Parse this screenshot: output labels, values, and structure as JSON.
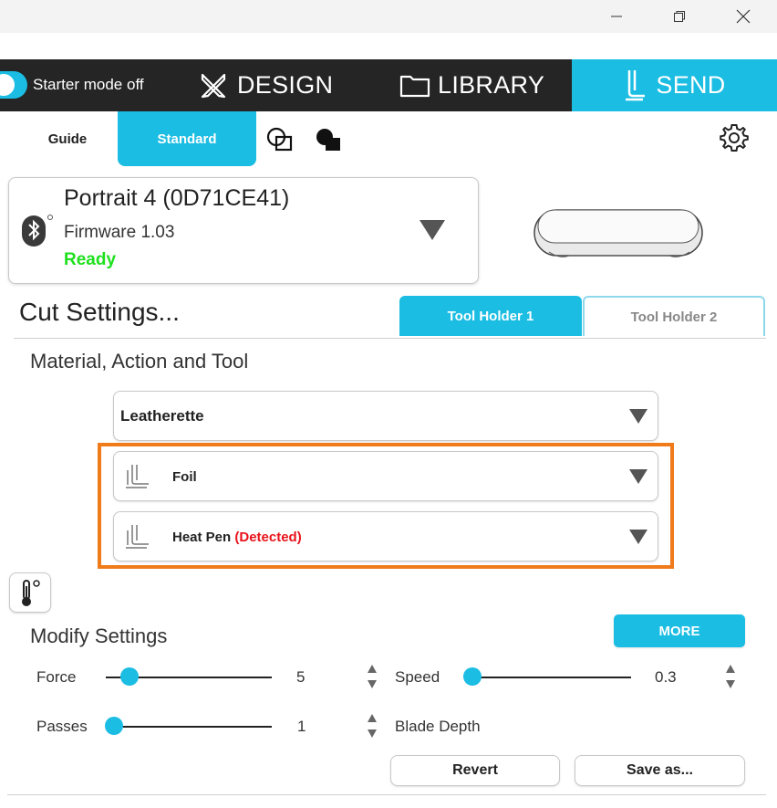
{
  "window": {
    "controls": [
      "minimize",
      "maximize",
      "close"
    ]
  },
  "nav": {
    "starter_mode_label": "Starter mode off",
    "design_label": "DESIGN",
    "library_label": "LIBRARY",
    "send_label": "SEND"
  },
  "subtabs": {
    "guide_label": "Guide",
    "standard_label": "Standard"
  },
  "device": {
    "name": "Portrait 4 (0D71CE41)",
    "firmware": "Firmware 1.03",
    "status": "Ready"
  },
  "cut_settings": {
    "title": "Cut Settings...",
    "tool_holder_1": "Tool Holder 1",
    "tool_holder_2": "Tool Holder 2",
    "section_label": "Material, Action and Tool",
    "material": "Leatherette",
    "action": "Foil",
    "tool": "Heat Pen",
    "tool_status": "(Detected)"
  },
  "modify": {
    "title": "Modify Settings",
    "more_label": "MORE",
    "force_label": "Force",
    "force_value": "5",
    "speed_label": "Speed",
    "speed_value": "0.3",
    "passes_label": "Passes",
    "passes_value": "1",
    "blade_depth_label": "Blade Depth",
    "revert_label": "Revert",
    "save_as_label": "Save as..."
  },
  "colors": {
    "accent": "#1bbde3",
    "nav_bg": "#252525",
    "ready": "#1ee01e",
    "detected": "#e8131b",
    "highlight": "#f07b1a"
  }
}
